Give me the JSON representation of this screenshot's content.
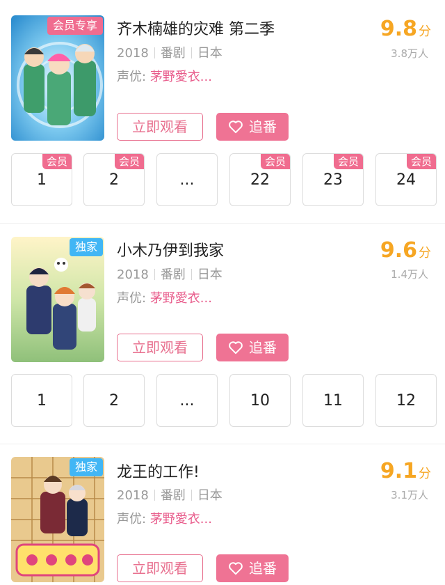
{
  "anime": [
    {
      "title": "齐木楠雄的灾难 第二季",
      "badge": "会员专享",
      "year": "2018",
      "type": "番剧",
      "region": "日本",
      "va_label": "声优:",
      "va_names": "茅野愛衣...",
      "score": "9.8",
      "score_unit": "分",
      "views": "3.8万人",
      "watch_label": "立即观看",
      "follow_label": "追番",
      "episodes": [
        {
          "label": "1",
          "tag": "会员"
        },
        {
          "label": "2",
          "tag": "会员"
        },
        {
          "label": "...",
          "tag": ""
        },
        {
          "label": "22",
          "tag": "会员"
        },
        {
          "label": "23",
          "tag": "会员"
        },
        {
          "label": "24",
          "tag": "会员"
        }
      ]
    },
    {
      "title": "小木乃伊到我家",
      "badge": "独家",
      "year": "2018",
      "type": "番剧",
      "region": "日本",
      "va_label": "声优:",
      "va_names": "茅野愛衣...",
      "score": "9.6",
      "score_unit": "分",
      "views": "1.4万人",
      "watch_label": "立即观看",
      "follow_label": "追番",
      "episodes": [
        {
          "label": "1",
          "tag": ""
        },
        {
          "label": "2",
          "tag": ""
        },
        {
          "label": "...",
          "tag": ""
        },
        {
          "label": "10",
          "tag": ""
        },
        {
          "label": "11",
          "tag": ""
        },
        {
          "label": "12",
          "tag": ""
        }
      ]
    },
    {
      "title": "龙王的工作!",
      "badge": "独家",
      "year": "2018",
      "type": "番剧",
      "region": "日本",
      "va_label": "声优:",
      "va_names": "茅野愛衣...",
      "score": "9.1",
      "score_unit": "分",
      "views": "3.1万人",
      "watch_label": "立即观看",
      "follow_label": "追番",
      "episodes": []
    }
  ],
  "colors": {
    "accent_pink": "#ef7394",
    "score_orange": "#f6a623",
    "exclusive_blue": "#41b6f5"
  },
  "icons": {
    "follow": "heart-outline-icon"
  }
}
